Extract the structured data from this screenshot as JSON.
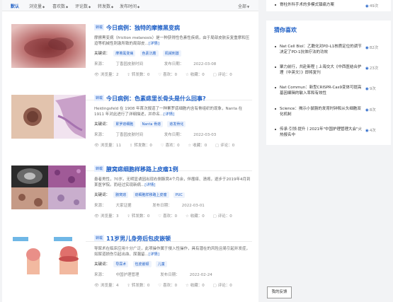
{
  "sort_bar": {
    "items": [
      {
        "label": "默认",
        "active": true
      },
      {
        "label": "浏览量",
        "active": false
      },
      {
        "label": "喜欢数",
        "active": false
      },
      {
        "label": "评论数",
        "active": false
      },
      {
        "label": "转发数",
        "active": false
      },
      {
        "label": "发布时间",
        "active": false
      }
    ],
    "filter_label": "全部"
  },
  "labels": {
    "keywords": "关键词：",
    "source_prefix": "来源：",
    "date_prefix": "发布日期：",
    "views": "浏览量：",
    "forwards": "转发数：",
    "likes": "喜欢：",
    "favorites": "收藏：",
    "comments": "评论："
  },
  "articles": [
    {
      "badge": "转载",
      "title": "今日病例：独特的摩擦黑变病",
      "summary": "摩擦黑变病（friction melanosis）是一种获得性色素性疾病，由于局部皮肤反复重摩和压迫等机械性刺激所致的局部皮...",
      "detail": "[详情]",
      "keywords": [
        "摩擦黑变病",
        "色素沉着",
        "机械刺激"
      ],
      "source": "丁香园皮肤时间",
      "date": "2022-03-08",
      "views": "2",
      "forwards": "0",
      "likes": "0",
      "favorites": "0",
      "comments": "0"
    },
    {
      "badge": "转载",
      "title": "今日病例：色素痣里长骨头是什么回事?",
      "summary": "Heidingsfeld 在 1908 年首次报道了一种累罗痣细胞内含有骨组织的现象，Nanta 在 1911 年对此进行了详细描述，并命名...",
      "detail": "[详情]",
      "keywords": [
        "累罗痣细胞",
        "Nanta 骨痣",
        "痣发骨化"
      ],
      "source": "丁香园皮肤时间",
      "date": "2022-03-03",
      "views": "11",
      "forwards": "0",
      "likes": "0",
      "favorites": "0",
      "comments": "0"
    },
    {
      "badge": "转载",
      "title": "腋窝痣细胞样移路上皮瘤1例",
      "summary": "患者男性，70岁。无明显诱因出现右侧腋窝4个月余，伴瘙痒、溃疡，逐步于2019年4月到某医学院。而经过实现新病...",
      "detail": "[详情]",
      "keywords": [
        "腋窝痣",
        "痣细胞样移路上皮瘤",
        "PUC"
      ],
      "source": "大家证据",
      "date": "2022-03-01",
      "views": "3",
      "forwards": "0",
      "likes": "0",
      "favorites": "0",
      "comments": "0"
    },
    {
      "badge": "转载",
      "title": "11岁男儿身旁后包皮嵌顿",
      "summary": "导尿术在临床应用十分广泛，此项操作属于侵入性操作，具有潜在的风险且易引起并发症，如尿道损伤引起出血、尿潴留...",
      "detail": "[详情]",
      "keywords": [
        "导尿术",
        "包皮嵌顿",
        "儿童"
      ],
      "source": "中国护理管理",
      "date": "2022-02-24",
      "views": "4",
      "forwards": "0",
      "likes": "0",
      "favorites": "0",
      "comments": "0"
    }
  ],
  "sidebar": {
    "top_item": {
      "text": "脊柱外科手术的多模式镇痛方案",
      "count": "49次"
    },
    "title": "猜你喜欢",
    "items": [
      {
        "text": "Nat Cell Biol：乙酰化对PD-L1核质定位的调节决定了PD-1抗体疗法的功效",
        "count": "82次"
      },
      {
        "text": "聚力前行，共赴新程 | 上海交大《中西医结合护理（中英文）》即将复刊",
        "count": "23次"
      },
      {
        "text": "Nat Commun：新型CRISPR-Cas9变体可提高基因编辑的敏入率和有效性",
        "count": "9次"
      },
      {
        "text": "Science：揭示小鼠肠的发育时钟和从头细胞双化机制",
        "count": "8次"
      },
      {
        "text": "传承·引领·提升丨2021年\"中国护理管理大会\"火热报名中",
        "count": "4次"
      }
    ]
  },
  "feedback_button": "我的反馈"
}
